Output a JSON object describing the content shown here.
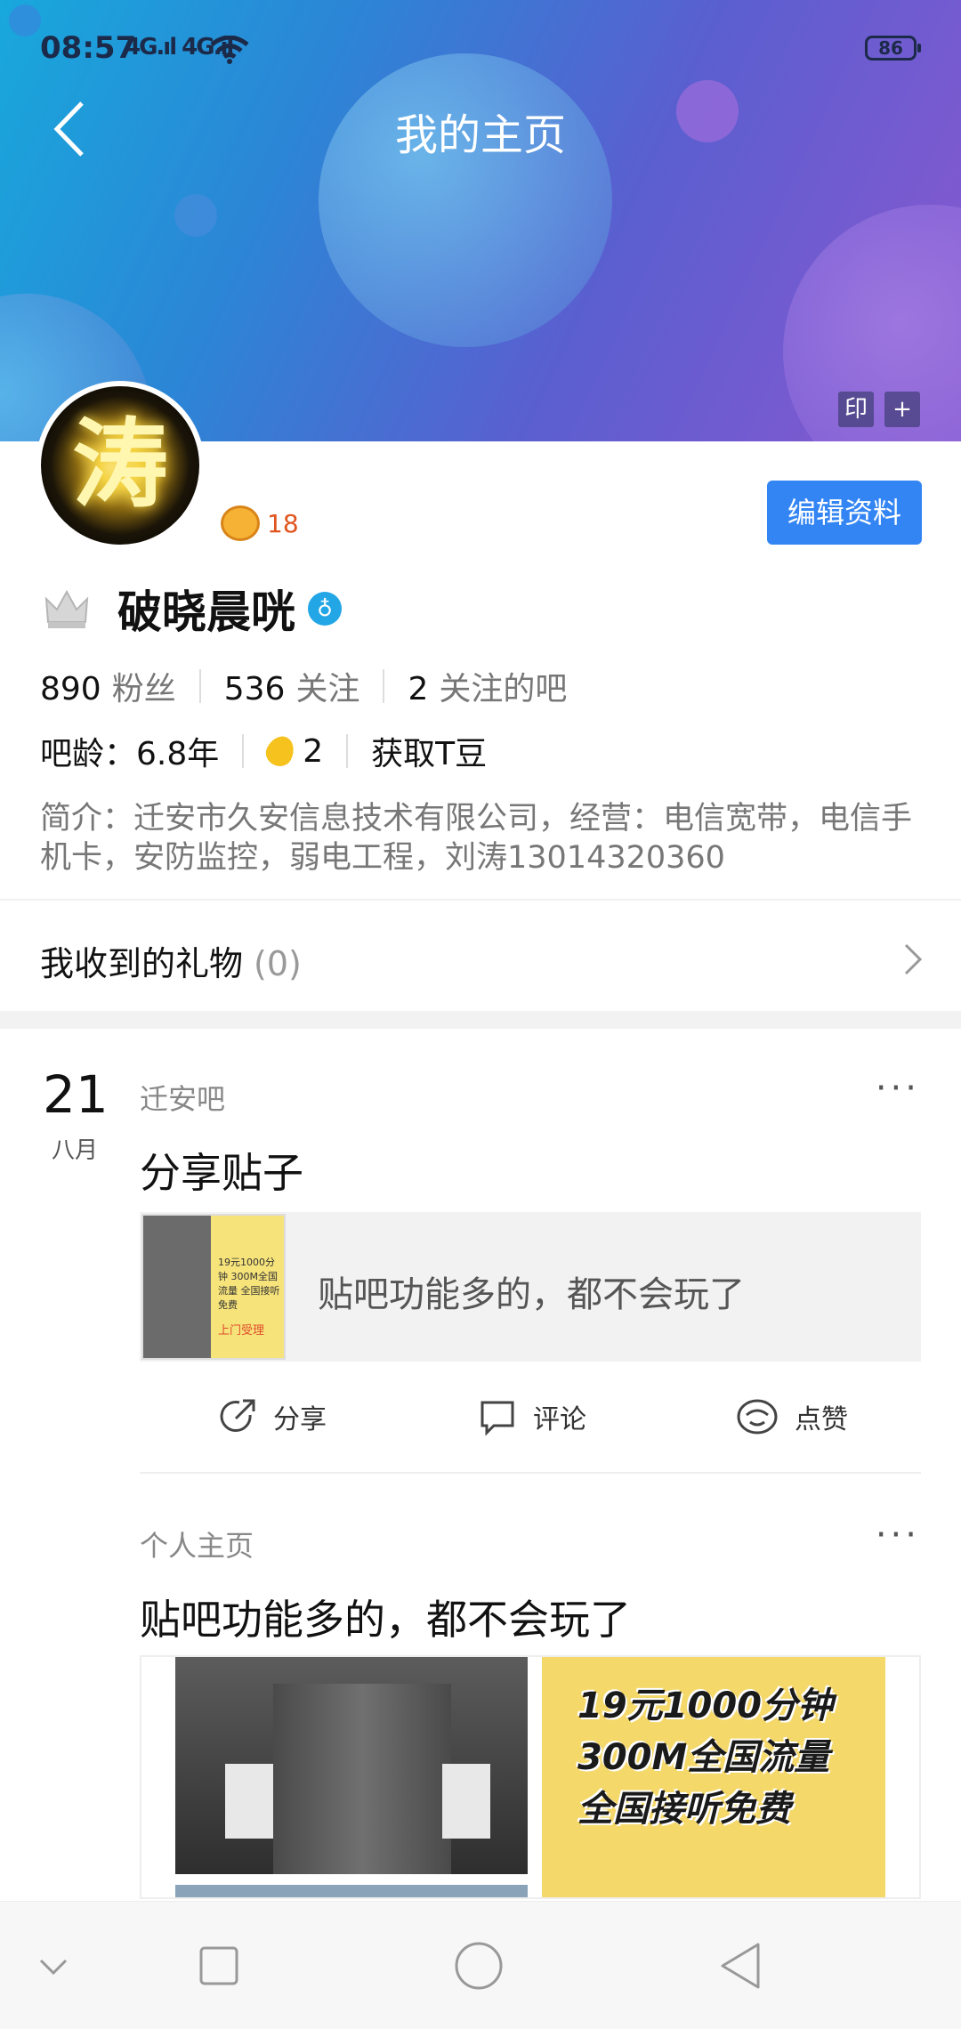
{
  "status_bar": {
    "time": "08:57",
    "signal": "4G.ıl 4G.ıl",
    "battery": "86"
  },
  "header": {
    "title": "我的主页",
    "corner_btn_1": "印",
    "corner_btn_2": "+"
  },
  "profile": {
    "avatar_char": "涛",
    "level": "18",
    "edit_label": "编辑资料",
    "username": "破晓晨咣",
    "verified_mark": "♁",
    "stats": [
      {
        "num": "890",
        "label": "粉丝"
      },
      {
        "num": "536",
        "label": "关注"
      },
      {
        "num": "2",
        "label": "关注的吧"
      }
    ],
    "bar_age": "吧龄：6.8年",
    "t_beans": "2",
    "get_beans": "获取T豆",
    "bio": "简介：迁安市久安信息技术有限公司，经营：电信宽带，电信手机卡，安防监控，弱电工程，刘涛13014320360"
  },
  "gifts": {
    "label": "我收到的礼物",
    "count": "(0)"
  },
  "feed": [
    {
      "day": "21",
      "month": "八月",
      "forum": "迁安吧",
      "more": "···",
      "title": "分享贴子",
      "shared_text": "贴吧功能多的，都不会玩了",
      "thumb_text_1": "19元1000分钟 300M全国流量 全国接听免费",
      "thumb_text_2": "上门受理",
      "actions": {
        "share": "分享",
        "comment": "评论",
        "like": "点赞"
      }
    },
    {
      "forum": "个人主页",
      "more": "···",
      "title": "贴吧功能多的，都不会玩了",
      "image_lines": [
        "19元1000分钟",
        "300M全国流量",
        "全国接听免费"
      ]
    }
  ],
  "colors": {
    "accent": "#3385f3",
    "level": "#e0541e",
    "banner_start": "#18a8dc",
    "banner_end": "#8a57cf"
  }
}
